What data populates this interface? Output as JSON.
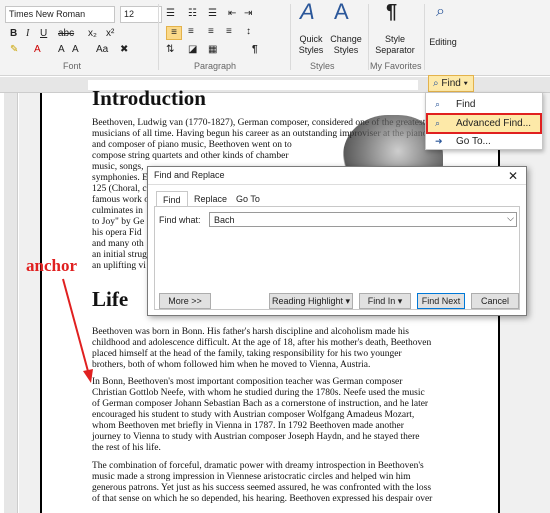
{
  "ribbon": {
    "font_name": "Times New Roman",
    "font_size": "12",
    "group_font": "Font",
    "group_paragraph": "Paragraph",
    "group_styles": "Styles",
    "group_favorites": "My Favorites",
    "quick_styles": "Quick\nStyles",
    "change_styles": "Change\nStyles",
    "style_separator": "Style\nSeparator",
    "editing": "Editing"
  },
  "find_button": {
    "label": "Find"
  },
  "find_menu": {
    "items": [
      {
        "label": "Find",
        "icon": "find-icon"
      },
      {
        "label": "Advanced Find...",
        "icon": "find-icon"
      },
      {
        "label": "Go To...",
        "icon": "goto-arrow-icon"
      }
    ],
    "highlight_color": "#e02020"
  },
  "document": {
    "heading_top": "Introduction",
    "intro_p1_line1": "Beethoven, Ludwig van (1770-1827), German composer, considered one of the greatest",
    "intro_p1_line2": "musicians of all time. Having begun his career as an outstanding improviser at the piano",
    "intro_p1_line3": "and composer of piano music, Beethoven went on to",
    "intro_p1_line4": "compose string quartets and other kinds of chamber",
    "intro_p1_line5": "music, songs,",
    "intro_p1_line6": "symphonies. E",
    "intro_p1_line7": "125 (Choral, c",
    "intro_p1_line8": "famous work o",
    "intro_p1_line9": "culminates in",
    "intro_p1_line10": "to Joy\" by Ge",
    "intro_p1_line11": "his opera Fid",
    "intro_p1_line12": "and many oth",
    "intro_p1_line13": "an initial strug",
    "intro_p1_line14": "an uplifting vi",
    "heading_life": "Life",
    "life_p1": [
      "Beethoven was born in Bonn. His father's harsh discipline and alcoholism made his",
      "childhood and adolescence difficult. At the age of 18, after his mother's death, Beethoven",
      "placed himself at the head of the family, taking responsibility for his two younger",
      "brothers, both of whom followed him when he moved to Vienna, Austria."
    ],
    "life_p2": [
      "In Bonn, Beethoven's most important composition teacher was German composer",
      "Christian Gottlob Neefe, with whom he studied during the 1780s. Neefe used the music",
      "of German composer Johann Sebastian Bach as a cornerstone of instruction, and he later",
      "encouraged his student to study with Austrian composer Wolfgang Amadeus Mozart,",
      "whom Beethoven met briefly in Vienna in 1787. In 1792 Beethoven made another",
      "journey to Vienna to study with Austrian composer Joseph Haydn, and he stayed there",
      "the rest of his life."
    ],
    "life_p3": [
      "The combination of forceful, dramatic power with dreamy introspection in Beethoven's",
      "music made a strong impression in Viennese aristocratic circles and helped win him",
      "generous patrons. Yet just as his success seemed assured, he was confronted with the loss",
      "of that sense on which he so depended, his hearing. Beethoven expressed his despair over"
    ]
  },
  "dialog": {
    "title": "Find and Replace",
    "tabs": [
      "Find",
      "Replace",
      "Go To"
    ],
    "find_what_label": "Find what:",
    "find_what_value": "Bach",
    "more_button": "More >>",
    "reading_highlight_button": "Reading Highlight",
    "find_in_button": "Find In",
    "find_next_button": "Find Next",
    "cancel_button": "Cancel"
  },
  "annotation": {
    "anchor_label": "anchor",
    "color": "#e02020"
  }
}
